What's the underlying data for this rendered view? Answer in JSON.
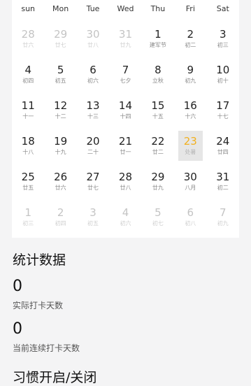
{
  "calendar": {
    "weekdays": [
      "sun",
      "Mon",
      "Tue",
      "Wed",
      "Thu",
      "Fri",
      "Sat"
    ],
    "weeks": [
      [
        {
          "num": "28",
          "lunar": "廿六",
          "muted": true
        },
        {
          "num": "29",
          "lunar": "廿七",
          "muted": true
        },
        {
          "num": "30",
          "lunar": "廿八",
          "muted": true
        },
        {
          "num": "31",
          "lunar": "廿九",
          "muted": true
        },
        {
          "num": "1",
          "lunar": "建军节",
          "muted": false
        },
        {
          "num": "2",
          "lunar": "初二",
          "muted": false
        },
        {
          "num": "3",
          "lunar": "初三",
          "muted": false
        }
      ],
      [
        {
          "num": "4",
          "lunar": "初四",
          "muted": false
        },
        {
          "num": "5",
          "lunar": "初五",
          "muted": false
        },
        {
          "num": "6",
          "lunar": "初六",
          "muted": false
        },
        {
          "num": "7",
          "lunar": "七夕",
          "muted": false
        },
        {
          "num": "8",
          "lunar": "立秋",
          "muted": false
        },
        {
          "num": "9",
          "lunar": "初九",
          "muted": false
        },
        {
          "num": "10",
          "lunar": "初十",
          "muted": false
        }
      ],
      [
        {
          "num": "11",
          "lunar": "十一",
          "muted": false
        },
        {
          "num": "12",
          "lunar": "十二",
          "muted": false
        },
        {
          "num": "13",
          "lunar": "十三",
          "muted": false
        },
        {
          "num": "14",
          "lunar": "十四",
          "muted": false
        },
        {
          "num": "15",
          "lunar": "十五",
          "muted": false
        },
        {
          "num": "16",
          "lunar": "十六",
          "muted": false
        },
        {
          "num": "17",
          "lunar": "十七",
          "muted": false
        }
      ],
      [
        {
          "num": "18",
          "lunar": "十八",
          "muted": false
        },
        {
          "num": "19",
          "lunar": "十九",
          "muted": false
        },
        {
          "num": "20",
          "lunar": "二十",
          "muted": false
        },
        {
          "num": "21",
          "lunar": "廿一",
          "muted": false
        },
        {
          "num": "22",
          "lunar": "廿二",
          "muted": false
        },
        {
          "num": "23",
          "lunar": "处暑",
          "muted": false,
          "today": true
        },
        {
          "num": "24",
          "lunar": "廿四",
          "muted": false
        }
      ],
      [
        {
          "num": "25",
          "lunar": "廿五",
          "muted": false
        },
        {
          "num": "26",
          "lunar": "廿六",
          "muted": false
        },
        {
          "num": "27",
          "lunar": "廿七",
          "muted": false
        },
        {
          "num": "28",
          "lunar": "廿八",
          "muted": false
        },
        {
          "num": "29",
          "lunar": "廿九",
          "muted": false
        },
        {
          "num": "30",
          "lunar": "八月",
          "muted": false
        },
        {
          "num": "31",
          "lunar": "初二",
          "muted": false
        }
      ],
      [
        {
          "num": "1",
          "lunar": "初三",
          "muted": true
        },
        {
          "num": "2",
          "lunar": "初四",
          "muted": true
        },
        {
          "num": "3",
          "lunar": "初五",
          "muted": true
        },
        {
          "num": "4",
          "lunar": "初六",
          "muted": true
        },
        {
          "num": "5",
          "lunar": "初七",
          "muted": true
        },
        {
          "num": "6",
          "lunar": "初八",
          "muted": true
        },
        {
          "num": "7",
          "lunar": "初九",
          "muted": true
        }
      ]
    ],
    "today_color": "#f2b01e"
  },
  "stats": {
    "title": "统计数据",
    "actual_days_value": "0",
    "actual_days_label": "实际打卡天数",
    "streak_value": "0",
    "streak_label": "当前连续打卡天数"
  },
  "habit_toggle": {
    "title": "习惯开启/关闭"
  }
}
